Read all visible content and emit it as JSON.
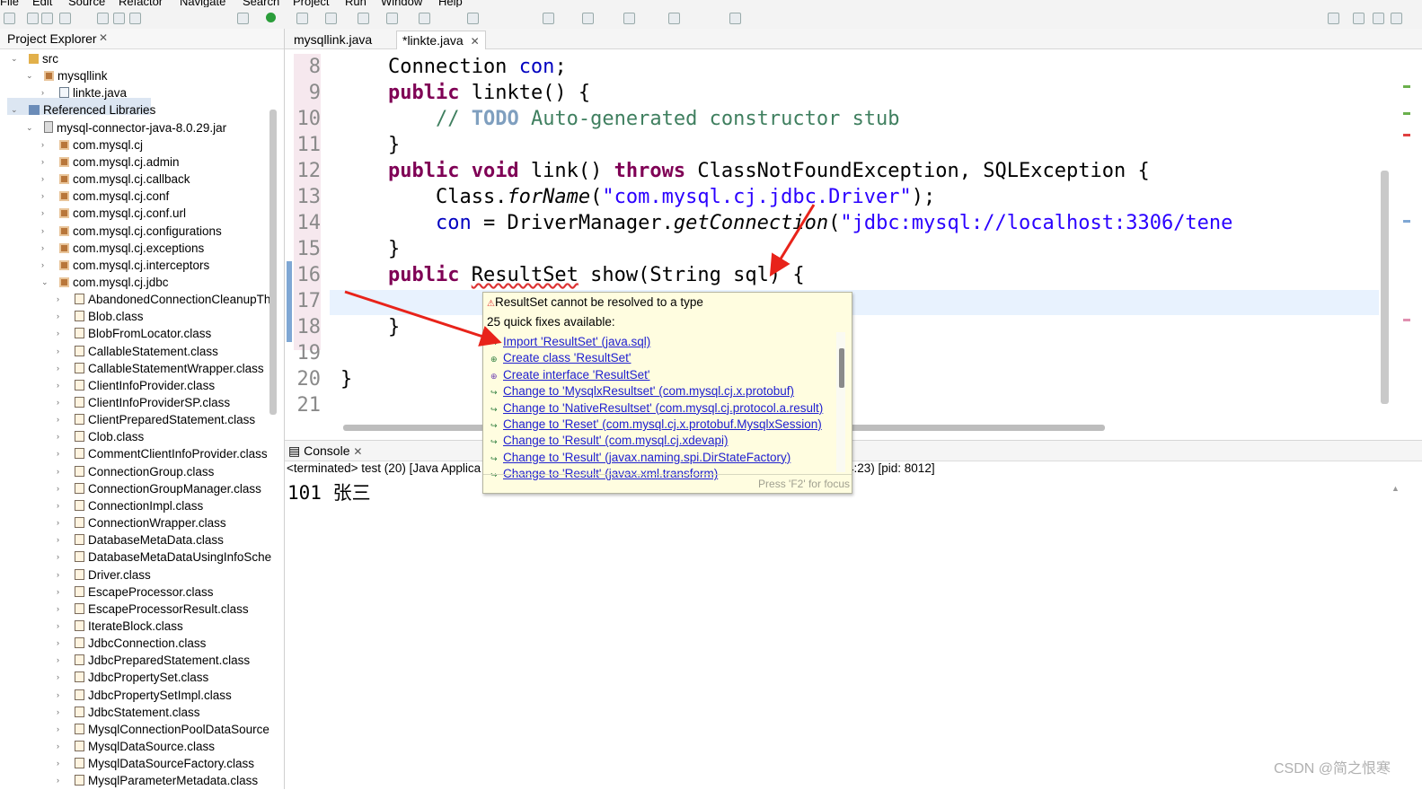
{
  "menu": [
    "File",
    "Edit",
    "Source",
    "Refactor",
    "Navigate",
    "Search",
    "Project",
    "Run",
    "Window",
    "Help"
  ],
  "explorer": {
    "title": "Project Explorer",
    "close": "✕",
    "tree": [
      {
        "label": "src",
        "depth": 0,
        "twisty": "⌄",
        "icon": "src"
      },
      {
        "label": "mysqllink",
        "depth": 1,
        "twisty": "⌄",
        "icon": "pkg"
      },
      {
        "label": "linkte.java",
        "depth": 2,
        "twisty": "›",
        "icon": "file"
      },
      {
        "label": "Referenced Libraries",
        "depth": 0,
        "twisty": "⌄",
        "icon": "lib"
      },
      {
        "label": "mysql-connector-java-8.0.29.jar",
        "depth": 1,
        "twisty": "⌄",
        "icon": "jar"
      },
      {
        "label": "com.mysql.cj",
        "depth": 2,
        "twisty": "›",
        "icon": "pkg"
      },
      {
        "label": "com.mysql.cj.admin",
        "depth": 2,
        "twisty": "›",
        "icon": "pkg"
      },
      {
        "label": "com.mysql.cj.callback",
        "depth": 2,
        "twisty": "›",
        "icon": "pkg"
      },
      {
        "label": "com.mysql.cj.conf",
        "depth": 2,
        "twisty": "›",
        "icon": "pkg"
      },
      {
        "label": "com.mysql.cj.conf.url",
        "depth": 2,
        "twisty": "›",
        "icon": "pkg"
      },
      {
        "label": "com.mysql.cj.configurations",
        "depth": 2,
        "twisty": "›",
        "icon": "pkg"
      },
      {
        "label": "com.mysql.cj.exceptions",
        "depth": 2,
        "twisty": "›",
        "icon": "pkg"
      },
      {
        "label": "com.mysql.cj.interceptors",
        "depth": 2,
        "twisty": "›",
        "icon": "pkg"
      },
      {
        "label": "com.mysql.cj.jdbc",
        "depth": 2,
        "twisty": "⌄",
        "icon": "pkg"
      },
      {
        "label": "AbandonedConnectionCleanupTh",
        "depth": 3,
        "twisty": "›",
        "icon": "class"
      },
      {
        "label": "Blob.class",
        "depth": 3,
        "twisty": "›",
        "icon": "class"
      },
      {
        "label": "BlobFromLocator.class",
        "depth": 3,
        "twisty": "›",
        "icon": "class"
      },
      {
        "label": "CallableStatement.class",
        "depth": 3,
        "twisty": "›",
        "icon": "class"
      },
      {
        "label": "CallableStatementWrapper.class",
        "depth": 3,
        "twisty": "›",
        "icon": "class"
      },
      {
        "label": "ClientInfoProvider.class",
        "depth": 3,
        "twisty": "›",
        "icon": "class"
      },
      {
        "label": "ClientInfoProviderSP.class",
        "depth": 3,
        "twisty": "›",
        "icon": "class"
      },
      {
        "label": "ClientPreparedStatement.class",
        "depth": 3,
        "twisty": "›",
        "icon": "class"
      },
      {
        "label": "Clob.class",
        "depth": 3,
        "twisty": "›",
        "icon": "class"
      },
      {
        "label": "CommentClientInfoProvider.class",
        "depth": 3,
        "twisty": "›",
        "icon": "class"
      },
      {
        "label": "ConnectionGroup.class",
        "depth": 3,
        "twisty": "›",
        "icon": "class"
      },
      {
        "label": "ConnectionGroupManager.class",
        "depth": 3,
        "twisty": "›",
        "icon": "class"
      },
      {
        "label": "ConnectionImpl.class",
        "depth": 3,
        "twisty": "›",
        "icon": "class"
      },
      {
        "label": "ConnectionWrapper.class",
        "depth": 3,
        "twisty": "›",
        "icon": "class"
      },
      {
        "label": "DatabaseMetaData.class",
        "depth": 3,
        "twisty": "›",
        "icon": "class"
      },
      {
        "label": "DatabaseMetaDataUsingInfoSche",
        "depth": 3,
        "twisty": "›",
        "icon": "class"
      },
      {
        "label": "Driver.class",
        "depth": 3,
        "twisty": "›",
        "icon": "class"
      },
      {
        "label": "EscapeProcessor.class",
        "depth": 3,
        "twisty": "›",
        "icon": "class"
      },
      {
        "label": "EscapeProcessorResult.class",
        "depth": 3,
        "twisty": "›",
        "icon": "class"
      },
      {
        "label": "IterateBlock.class",
        "depth": 3,
        "twisty": "›",
        "icon": "class"
      },
      {
        "label": "JdbcConnection.class",
        "depth": 3,
        "twisty": "›",
        "icon": "class"
      },
      {
        "label": "JdbcPreparedStatement.class",
        "depth": 3,
        "twisty": "›",
        "icon": "class"
      },
      {
        "label": "JdbcPropertySet.class",
        "depth": 3,
        "twisty": "›",
        "icon": "class"
      },
      {
        "label": "JdbcPropertySetImpl.class",
        "depth": 3,
        "twisty": "›",
        "icon": "class"
      },
      {
        "label": "JdbcStatement.class",
        "depth": 3,
        "twisty": "›",
        "icon": "class"
      },
      {
        "label": "MysqlConnectionPoolDataSource",
        "depth": 3,
        "twisty": "›",
        "icon": "class"
      },
      {
        "label": "MysqlDataSource.class",
        "depth": 3,
        "twisty": "›",
        "icon": "class"
      },
      {
        "label": "MysqlDataSourceFactory.class",
        "depth": 3,
        "twisty": "›",
        "icon": "class"
      },
      {
        "label": "MysqlParameterMetadata.class",
        "depth": 3,
        "twisty": "›",
        "icon": "class"
      }
    ]
  },
  "editor": {
    "tabs": [
      {
        "label": "mysqllink.java",
        "active": false
      },
      {
        "label": "*linkte.java",
        "active": true,
        "close": "✕"
      }
    ],
    "lines": [
      {
        "n": "8",
        "segs": [
          [
            "",
            "    Connection "
          ],
          [
            "fld",
            "con"
          ],
          [
            "",
            ";"
          ]
        ]
      },
      {
        "n": "9",
        "segs": [
          [
            "",
            "    "
          ],
          [
            "kw",
            "public"
          ],
          [
            "",
            " linkte() {"
          ]
        ]
      },
      {
        "n": "10",
        "segs": [
          [
            "",
            "        "
          ],
          [
            "cmt",
            "// "
          ],
          [
            "todo",
            "TODO"
          ],
          [
            "cmt",
            " Auto-generated constructor stub"
          ]
        ]
      },
      {
        "n": "11",
        "segs": [
          [
            "",
            "    }"
          ]
        ]
      },
      {
        "n": "12",
        "segs": [
          [
            "",
            "    "
          ],
          [
            "kw",
            "public void"
          ],
          [
            "",
            " link() "
          ],
          [
            "kw",
            "throws"
          ],
          [
            "",
            " ClassNotFoundException, SQLException {"
          ]
        ]
      },
      {
        "n": "13",
        "segs": [
          [
            "",
            "        Class."
          ],
          [
            "ital",
            "forName"
          ],
          [
            "",
            "("
          ],
          [
            "str",
            "\"com.mysql.cj.jdbc.Driver\""
          ],
          [
            "",
            ");"
          ]
        ]
      },
      {
        "n": "14",
        "segs": [
          [
            "",
            "        "
          ],
          [
            "fld",
            "con"
          ],
          [
            "",
            " = DriverManager."
          ],
          [
            "ital",
            "getConnection"
          ],
          [
            "",
            "("
          ],
          [
            "str",
            "\"jdbc:mysql://localhost:3306/tene"
          ]
        ]
      },
      {
        "n": "15",
        "segs": [
          [
            "",
            "    }"
          ]
        ]
      },
      {
        "n": "16",
        "segs": [
          [
            "",
            "    "
          ],
          [
            "kw",
            "public"
          ],
          [
            "",
            " "
          ],
          [
            "err",
            "ResultSet"
          ],
          [
            "",
            " show(String sql) {"
          ]
        ]
      },
      {
        "n": "17",
        "segs": [
          [
            "",
            ""
          ]
        ]
      },
      {
        "n": "18",
        "segs": [
          [
            "",
            "    }"
          ]
        ]
      },
      {
        "n": "19",
        "segs": [
          [
            "",
            ""
          ]
        ]
      },
      {
        "n": "20",
        "segs": [
          [
            "",
            "}"
          ]
        ]
      },
      {
        "n": "21",
        "segs": [
          [
            "",
            ""
          ]
        ]
      }
    ]
  },
  "quickfix": {
    "problem": "ResultSet cannot be resolved to a type",
    "count": "25 quick fixes available:",
    "fixes": [
      "Import 'ResultSet' (java.sql)",
      "Create class 'ResultSet'",
      "Create interface 'ResultSet'",
      "Change to 'MysqlxResultset' (com.mysql.cj.x.protobuf)",
      "Change to 'NativeResultset' (com.mysql.cj.protocol.a.result)",
      "Change to 'Reset' (com.mysql.cj.x.protobuf.MysqlxSession)",
      "Change to 'Result' (com.mysql.cj.xdevapi)",
      "Change to 'Result' (javax.naming.spi.DirStateFactory)",
      "Change to 'Result' (javax.xml.transform)"
    ],
    "footer": "Press 'F2' for focus"
  },
  "console": {
    "title": "Console",
    "close": "✕",
    "status_left": "<terminated> test (20) [Java Applica",
    "status_right": "4:23) [pid: 8012]",
    "output": "101 张三"
  },
  "watermark": "CSDN @简之恨寒",
  "colors": {
    "keyword": "#7f0055",
    "string": "#2a00ff",
    "comment": "#3f7f5f",
    "link": "#2020d0",
    "arrow": "#e8231a"
  }
}
